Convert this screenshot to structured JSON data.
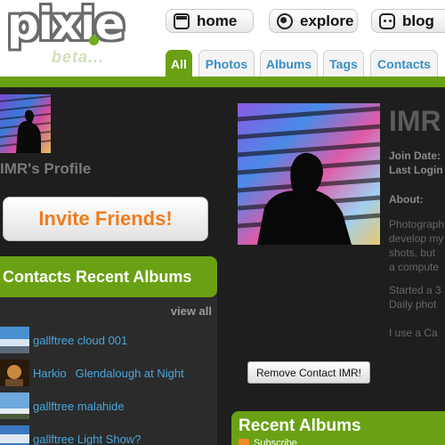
{
  "logo": {
    "name": "pixie",
    "beta": "beta..."
  },
  "nav": [
    {
      "label": "home",
      "icon": "home-icon"
    },
    {
      "label": "explore",
      "icon": "globe-icon"
    },
    {
      "label": "blog",
      "icon": "face-icon"
    }
  ],
  "tabs": [
    {
      "label": "All",
      "active": true
    },
    {
      "label": "Photos"
    },
    {
      "label": "Albums"
    },
    {
      "label": "Tags"
    },
    {
      "label": "Contacts"
    }
  ],
  "profile": {
    "title": "IMR's Profile",
    "name": "IMR"
  },
  "invite": {
    "label": "Invite Friends!"
  },
  "contacts_panel": {
    "title": "Contacts Recent Albums",
    "view_all": "view all",
    "albums": [
      {
        "owner": "gallftree",
        "title": "cloud 001"
      },
      {
        "owner": "Harkio",
        "title": "Glendalough at Night"
      },
      {
        "owner": "gallftree",
        "title": "malahide"
      },
      {
        "owner": "gallftree",
        "title": "Light Show?"
      }
    ]
  },
  "info": {
    "join_date_label": "Join Date:",
    "last_login_label": "Last Login",
    "about_label": "About:",
    "about_lines": [
      "Photograph",
      "develop my",
      "shots, but",
      "a compute",
      "",
      "Started a 3",
      "Daily phot",
      "",
      "I use a Ca"
    ]
  },
  "remove_button": {
    "label": "Remove Contact IMR!"
  },
  "recent_albums": {
    "title": "Recent Albums",
    "subscribe": "Subscribe"
  },
  "colors": {
    "accent_green": "#6aa114",
    "link_blue": "#4aa6dd",
    "orange": "#f07c1d",
    "background": "#1e1e1e"
  }
}
